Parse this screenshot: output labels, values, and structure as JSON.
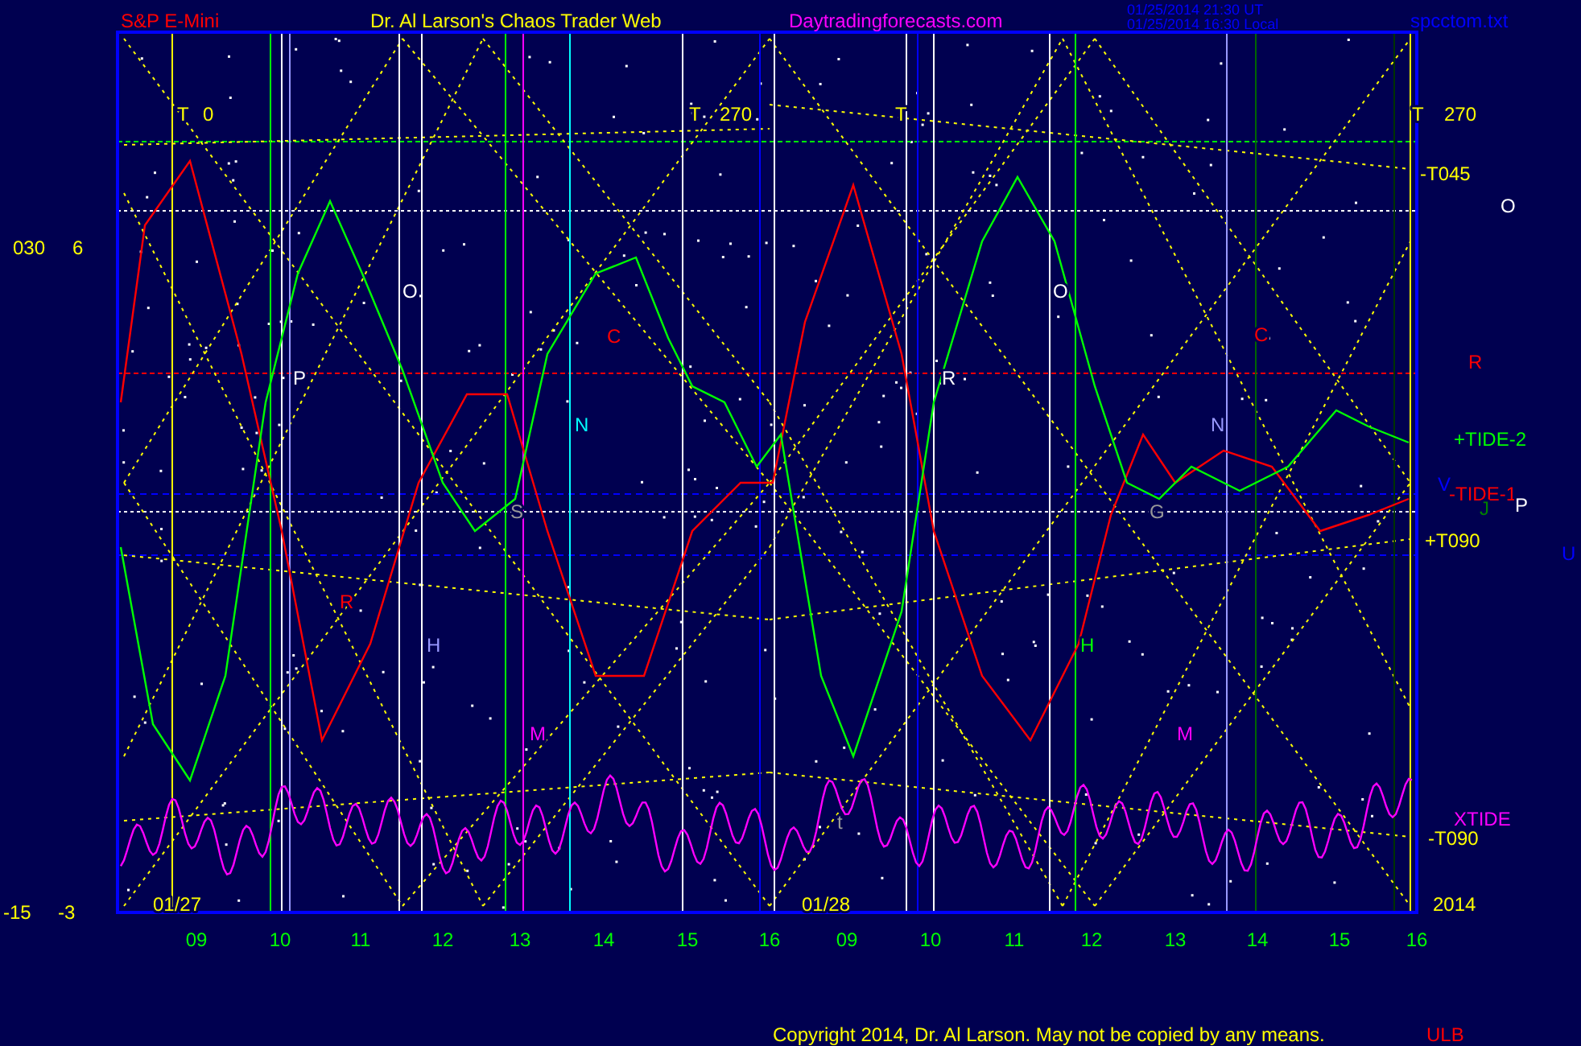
{
  "header": {
    "symbol": "S&P E-Mini",
    "title": "Dr. Al Larson's Chaos Trader Web",
    "site": "Daytradingforecasts.com",
    "timestamps": [
      "01/25/2014 21:30 UT",
      "01/25/2014 16:30 Local"
    ],
    "file": "spcctom.txt"
  },
  "y_labels": [
    "030",
    "6",
    "-15",
    "-3"
  ],
  "x_axis": {
    "ticks": [
      "09",
      "10",
      "11",
      "12",
      "13",
      "14",
      "15",
      "16",
      "09",
      "10",
      "11",
      "12",
      "13",
      "14",
      "15",
      "16"
    ],
    "dates": [
      "01/27",
      "01/28"
    ],
    "year": "2014"
  },
  "plot_labels": [
    {
      "text": "T",
      "color": "#ffff00"
    },
    {
      "text": "0",
      "color": "#ffff00"
    },
    {
      "text": "T",
      "color": "#ffff00"
    },
    {
      "text": "270",
      "color": "#ffff00"
    },
    {
      "text": "T",
      "color": "#ffff00"
    },
    {
      "text": "T",
      "color": "#ffff00"
    },
    {
      "text": "270",
      "color": "#ffff00"
    },
    {
      "text": "-T045",
      "color": "#ffff00"
    },
    {
      "text": "O",
      "color": "#ffffff"
    },
    {
      "text": "O",
      "color": "#ffffff"
    },
    {
      "text": "O",
      "color": "#ffffff"
    },
    {
      "text": "C",
      "color": "#ff0000"
    },
    {
      "text": "C",
      "color": "#ff0000"
    },
    {
      "text": "P",
      "color": "#ffffff"
    },
    {
      "text": "R",
      "color": "#ffffff"
    },
    {
      "text": "R",
      "color": "#ff0000"
    },
    {
      "text": "N",
      "color": "#00ffff"
    },
    {
      "text": "N",
      "color": "#9999ff"
    },
    {
      "text": "+TIDE-2",
      "color": "#00ff00"
    },
    {
      "text": "V",
      "color": "#0000ff"
    },
    {
      "text": "-TIDE-1",
      "color": "#ff0000"
    },
    {
      "text": "J",
      "color": "#008000"
    },
    {
      "text": "P",
      "color": "#ffffff"
    },
    {
      "text": "S",
      "color": "#999999"
    },
    {
      "text": "G",
      "color": "#999999"
    },
    {
      "text": "+T090",
      "color": "#ffff00"
    },
    {
      "text": "U",
      "color": "#0000ff"
    },
    {
      "text": "R",
      "color": "#ff0000"
    },
    {
      "text": "H",
      "color": "#9999ff"
    },
    {
      "text": "H",
      "color": "#00ff00"
    },
    {
      "text": "M",
      "color": "#ff00ff"
    },
    {
      "text": "M",
      "color": "#ff00ff"
    },
    {
      "text": "t",
      "color": "#999999"
    },
    {
      "text": "XTIDE",
      "color": "#ff00ff"
    },
    {
      "text": "-T090",
      "color": "#ffff00"
    }
  ],
  "footer": {
    "copyright": "Copyright 2014, Dr. Al Larson. May not be copied by any means.",
    "mark": "ULB"
  }
}
